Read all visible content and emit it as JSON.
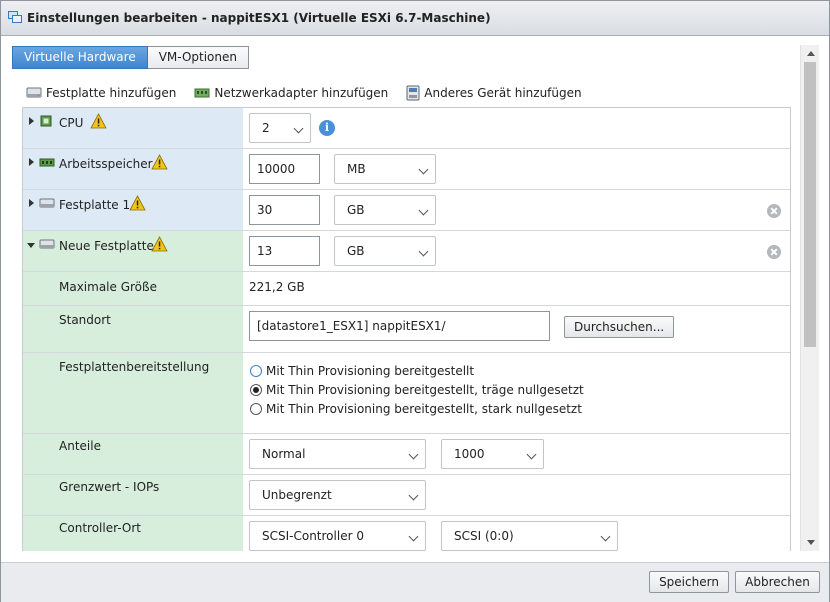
{
  "window": {
    "title": "Einstellungen bearbeiten - nappitESX1 (Virtuelle ESXi 6.7-Maschine)",
    "icon": "vm-settings-icon"
  },
  "tabs": [
    {
      "label": "Virtuelle Hardware",
      "active": true
    },
    {
      "label": "VM-Optionen",
      "active": false
    }
  ],
  "toolbar": {
    "add_disk": "Festplatte hinzufügen",
    "add_nic": "Netzwerkadapter hinzufügen",
    "add_other": "Anderes Gerät hinzufügen"
  },
  "hardware": {
    "cpu": {
      "label": "CPU",
      "value": "2"
    },
    "memory": {
      "label": "Arbeitsspeicher",
      "value": "10000",
      "unit": "MB"
    },
    "disk1": {
      "label": "Festplatte 1",
      "value": "30",
      "unit": "GB"
    },
    "new_disk": {
      "label": "Neue Festplatte",
      "value": "13",
      "unit": "GB",
      "max_size": {
        "label": "Maximale Größe",
        "value": "221,2 GB"
      },
      "location": {
        "label": "Standort",
        "value": "[datastore1_ESX1] nappitESX1/",
        "browse_button": "Durchsuchen..."
      },
      "provisioning": {
        "label": "Festplattenbereitstellung",
        "options": [
          {
            "label": "Mit Thin Provisioning bereitgestellt",
            "checked": false
          },
          {
            "label": "Mit Thin Provisioning bereitgestellt, träge nullgesetzt",
            "checked": true
          },
          {
            "label": "Mit Thin Provisioning bereitgestellt, stark nullgesetzt",
            "checked": false
          }
        ]
      },
      "shares": {
        "label": "Anteile",
        "level": "Normal",
        "value": "1000"
      },
      "iops_limit": {
        "label": "Grenzwert - IOPs",
        "value": "Unbegrenzt"
      },
      "controller": {
        "label": "Controller-Ort",
        "controller": "SCSI-Controller 0",
        "slot": "SCSI (0:0)"
      }
    }
  },
  "footer": {
    "save": "Speichern",
    "cancel": "Abbrechen"
  },
  "colors": {
    "accent": "#3f86cf",
    "row_blue": "#dde9f5",
    "row_green": "#d7eedd",
    "warning": "#f0c419"
  }
}
